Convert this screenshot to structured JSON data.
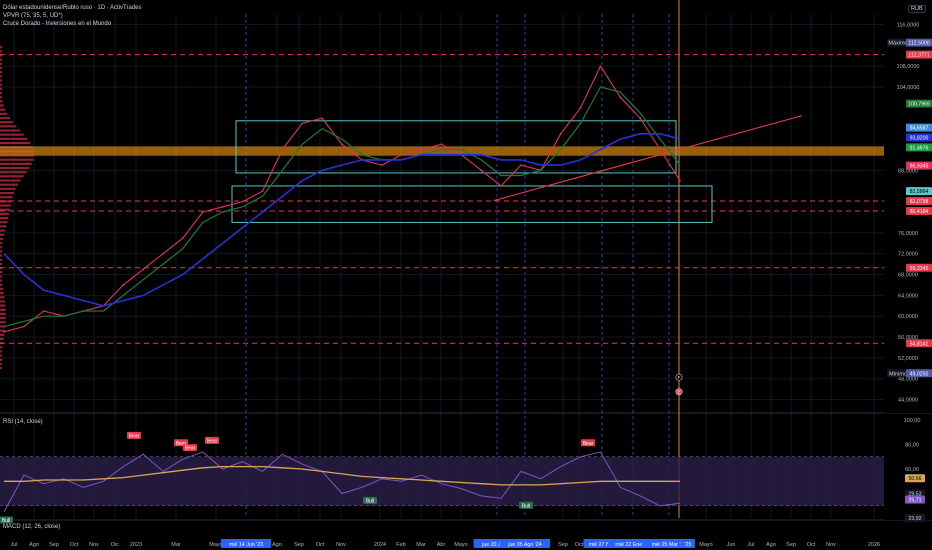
{
  "app": {
    "currency": "RUB"
  },
  "legends": {
    "main": [
      "Dólar estadounidense/Rublo ruso · 1D · ActivTrades",
      "VPVR (75, 35, 5, UD*)",
      "Cruce Dorado - Inversiones en el Mundo"
    ],
    "rsi": "RSI (14, close)",
    "macd": "MACD (12, 26, close)"
  },
  "colors": {
    "background": "#000000",
    "grid": "#131722",
    "price_line": "#e5315a",
    "sma_fast": "#1e7a36",
    "sma_slow": "#2432d8",
    "dashed_level": "#e8394b",
    "golden_band": "#c77f12",
    "box": "#5ec6c4",
    "trend": "#e8394b",
    "rsi_line": "#7e57c2",
    "rsi_ma": "#d8a55a",
    "rsi_band": "#2a1f4a",
    "event_line": "#3b4bd6",
    "current_line": "#e38a1d",
    "volume_profile": "#a8273c"
  },
  "price_axis": {
    "ticks": [
      "116,0000",
      "108,0000",
      "104,0000",
      "88,0000",
      "76,0000",
      "72,0000",
      "68,0000",
      "64,0000",
      "60,0000",
      "56,0000",
      "52,0000",
      "48,0000",
      "44,0000"
    ],
    "tick_values": [
      116,
      108,
      104,
      88,
      76,
      72,
      68,
      64,
      60,
      56,
      52,
      48,
      44
    ],
    "badges": [
      {
        "text": "Máximo",
        "value": 112.5,
        "bg": "#ffffff",
        "fg": "#000000",
        "kind": "label"
      },
      {
        "text": "112,5000",
        "value": 112.5,
        "bg": "#4e5aa8",
        "fg": "#ffffff",
        "kind": "value"
      },
      {
        "text": "112,3771",
        "value": 110.2,
        "bg": "#e8394b",
        "fg": "#ffffff",
        "kind": "value"
      },
      {
        "text": "100,7969",
        "value": 100.8,
        "bg": "#1f7a3a",
        "fg": "#ffffff",
        "kind": "value"
      },
      {
        "text": "94,6587",
        "value": 96.2,
        "bg": "#3e8fd8",
        "fg": "#ffffff",
        "kind": "value"
      },
      {
        "text": "93,8200",
        "value": 94.3,
        "bg": "#2432d8",
        "fg": "#ffffff",
        "kind": "value"
      },
      {
        "text": "91,4676",
        "value": 92.4,
        "bg": "#1a9e3f",
        "fg": "#ffffff",
        "kind": "value"
      },
      {
        "text": "86,9345",
        "value": 88.9,
        "bg": "#e5315a",
        "fg": "#ffffff",
        "kind": "value"
      },
      {
        "text": "82,5864",
        "value": 84.0,
        "bg": "#5ec6c4",
        "fg": "#000000",
        "kind": "value"
      },
      {
        "text": "82,0798",
        "value": 82.1,
        "bg": "#e8394b",
        "fg": "#ffffff",
        "kind": "value"
      },
      {
        "text": "80,4184",
        "value": 80.2,
        "bg": "#e8394b",
        "fg": "#ffffff",
        "kind": "value"
      },
      {
        "text": "69,3345",
        "value": 69.3,
        "bg": "#e8394b",
        "fg": "#ffffff",
        "kind": "value"
      },
      {
        "text": "54,8141",
        "value": 54.8,
        "bg": "#e8394b",
        "fg": "#ffffff",
        "kind": "value"
      },
      {
        "text": "Mínimo",
        "value": 49.05,
        "bg": "#ffffff",
        "fg": "#000000",
        "kind": "label"
      },
      {
        "text": "49,0250",
        "value": 49.05,
        "bg": "#4e5aa8",
        "fg": "#ffffff",
        "kind": "value"
      }
    ],
    "dashed_levels": [
      110.2,
      82.1,
      80.2,
      69.3,
      54.8
    ],
    "golden_band": [
      90.8,
      92.6
    ]
  },
  "rsi_axis": {
    "ticks": [
      "100,00",
      "80,00",
      "60,00",
      "40,00",
      "20,00"
    ],
    "tick_values": [
      100,
      80,
      60,
      40,
      20
    ],
    "badges": [
      {
        "text": "50,66",
        "value": 52.5,
        "bg": "#d8a55a",
        "fg": "#000000"
      },
      {
        "text": "29,53",
        "value": 40.0,
        "bg": "#131722",
        "fg": "#d1d4dc"
      },
      {
        "text": "25,71",
        "value": 35.0,
        "bg": "#7e57c2",
        "fg": "#ffffff"
      },
      {
        "text": "23,92",
        "value": 20.0,
        "bg": "#131722",
        "fg": "#d1d4dc"
      }
    ],
    "band": [
      30,
      70
    ]
  },
  "time_axis": {
    "labels": [
      {
        "text": "Jul",
        "x": 14
      },
      {
        "text": "Ago",
        "x": 34
      },
      {
        "text": "Sep",
        "x": 54
      },
      {
        "text": "Oct",
        "x": 74
      },
      {
        "text": "Nov",
        "x": 94
      },
      {
        "text": "Dic",
        "x": 115
      },
      {
        "text": "2023",
        "x": 136
      },
      {
        "text": "Mar",
        "x": 176
      },
      {
        "text": "Mayo",
        "x": 216
      },
      {
        "text": "Ago",
        "x": 277
      },
      {
        "text": "Sep",
        "x": 299
      },
      {
        "text": "Oct",
        "x": 320
      },
      {
        "text": "Nov",
        "x": 341
      },
      {
        "text": "2024",
        "x": 380
      },
      {
        "text": "Feb",
        "x": 401
      },
      {
        "text": "Mar",
        "x": 421
      },
      {
        "text": "Abr",
        "x": 441
      },
      {
        "text": "Mayo",
        "x": 461
      },
      {
        "text": "Sep",
        "x": 563
      },
      {
        "text": "Oct",
        "x": 579
      },
      {
        "text": "Mayo",
        "x": 706
      },
      {
        "text": "Jun",
        "x": 731
      },
      {
        "text": "Jul",
        "x": 751
      },
      {
        "text": "Ago",
        "x": 771
      },
      {
        "text": "Sep",
        "x": 791
      },
      {
        "text": "Oct",
        "x": 811
      },
      {
        "text": "Nov",
        "x": 831
      },
      {
        "text": "2026",
        "x": 874
      }
    ],
    "highlights": [
      {
        "text": "mié 14 Jun '23",
        "x": 246
      },
      {
        "text": "jue 20 Jun '2",
        "x": 497
      },
      {
        "text": "jue 05 Ago '24",
        "x": 525
      },
      {
        "text": "mié 27 Nov",
        "x": 602
      },
      {
        "text": "mié 22 Ene '25",
        "x": 633
      },
      {
        "text": "mié 25 Mar '25",
        "x": 669
      },
      {
        "text": "'25",
        "x": 688
      }
    ]
  },
  "signals": {
    "rsi_labels": [
      {
        "text": "Bear",
        "x": 134,
        "rsi": 87,
        "kind": "bear"
      },
      {
        "text": "Bear",
        "x": 181,
        "rsi": 81,
        "kind": "bear"
      },
      {
        "text": "Bear",
        "x": 190,
        "rsi": 77,
        "kind": "bear"
      },
      {
        "text": "Bear",
        "x": 212,
        "rsi": 83,
        "kind": "bear"
      },
      {
        "text": "Bear",
        "x": 588,
        "rsi": 81,
        "kind": "bear"
      },
      {
        "text": "Bull",
        "x": 6,
        "rsi": 18,
        "kind": "bull"
      },
      {
        "text": "Bull",
        "x": 370,
        "rsi": 34,
        "kind": "bull"
      },
      {
        "text": "Bull",
        "x": 526,
        "rsi": 30,
        "kind": "bull"
      }
    ],
    "price_markers": [
      {
        "text": "F",
        "x": 679,
        "value": 48.3
      },
      {
        "text": "E",
        "x": 679,
        "value": 45.5
      }
    ]
  },
  "chart_data": [
    {
      "type": "line",
      "title": "Dólar estadounidense/Rublo ruso · 1D · ActivTrades",
      "xlabel": "",
      "ylabel": "",
      "ylim": [
        42,
        118
      ],
      "x": [
        "2022-06",
        "2022-07",
        "2022-08",
        "2022-09",
        "2022-10",
        "2022-11",
        "2022-12",
        "2023-01",
        "2023-02",
        "2023-03",
        "2023-04",
        "2023-05",
        "2023-06",
        "2023-07",
        "2023-08",
        "2023-09",
        "2023-10",
        "2023-11",
        "2023-12",
        "2024-01",
        "2024-02",
        "2024-03",
        "2024-04",
        "2024-05",
        "2024-06",
        "2024-07",
        "2024-08",
        "2024-09",
        "2024-10",
        "2024-11",
        "2024-12",
        "2025-01",
        "2025-02",
        "2025-03",
        "2025-04"
      ],
      "series": [
        {
          "name": "price",
          "values": [
            57,
            58,
            61,
            60,
            61,
            62,
            66,
            69,
            72,
            75,
            80,
            81,
            82,
            84,
            92,
            97,
            98,
            93,
            90,
            89,
            91,
            92,
            93,
            91,
            88,
            85,
            89,
            88,
            95,
            100,
            108,
            102,
            98,
            92,
            86
          ]
        },
        {
          "name": "sma_fast",
          "values": [
            58,
            59,
            60,
            60,
            61,
            61,
            64,
            67,
            70,
            73,
            78,
            80,
            81,
            83,
            88,
            93,
            96,
            94,
            91,
            90,
            90,
            91,
            92,
            92,
            90,
            87,
            87,
            88,
            92,
            97,
            104,
            103,
            99,
            94,
            89
          ]
        },
        {
          "name": "sma_slow",
          "values": [
            72,
            68,
            65,
            64,
            63,
            62,
            63,
            64,
            66,
            68,
            71,
            74,
            77,
            80,
            83,
            86,
            88,
            89,
            90,
            90,
            90,
            91,
            91,
            91,
            91,
            90,
            90,
            89,
            89,
            90,
            92,
            94,
            95,
            95,
            94
          ]
        }
      ]
    },
    {
      "type": "line",
      "title": "RSI (14, close)",
      "xlabel": "",
      "ylabel": "",
      "ylim": [
        20,
        100
      ],
      "x": [
        "2022-06",
        "2022-07",
        "2022-08",
        "2022-09",
        "2022-10",
        "2022-11",
        "2022-12",
        "2023-01",
        "2023-02",
        "2023-03",
        "2023-04",
        "2023-05",
        "2023-06",
        "2023-07",
        "2023-08",
        "2023-09",
        "2023-10",
        "2023-11",
        "2023-12",
        "2024-01",
        "2024-02",
        "2024-03",
        "2024-04",
        "2024-05",
        "2024-06",
        "2024-07",
        "2024-08",
        "2024-09",
        "2024-10",
        "2024-11",
        "2024-12",
        "2025-01",
        "2025-02",
        "2025-03",
        "2025-04"
      ],
      "series": [
        {
          "name": "RSI",
          "values": [
            25,
            55,
            48,
            52,
            45,
            50,
            62,
            72,
            58,
            68,
            74,
            60,
            66,
            58,
            72,
            64,
            58,
            40,
            45,
            52,
            50,
            55,
            48,
            44,
            38,
            36,
            58,
            52,
            62,
            70,
            74,
            45,
            38,
            30,
            32
          ]
        },
        {
          "name": "RSI MA",
          "values": [
            50,
            50,
            51,
            51,
            51,
            52,
            53,
            55,
            57,
            59,
            61,
            62,
            62,
            62,
            61,
            60,
            58,
            56,
            54,
            53,
            52,
            51,
            50,
            49,
            48,
            47,
            47,
            47,
            48,
            49,
            50,
            50,
            50,
            50,
            50
          ]
        }
      ]
    }
  ]
}
